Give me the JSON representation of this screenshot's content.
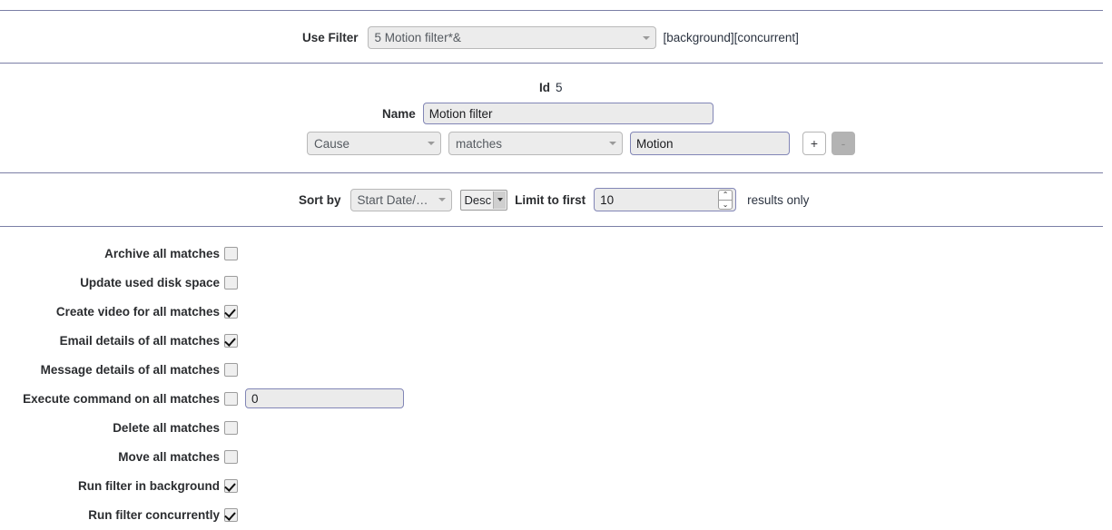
{
  "filter_bar": {
    "use_filter_label": "Use Filter",
    "selected_filter": "5 Motion filter*&",
    "tags": "[background][concurrent]"
  },
  "details": {
    "id_label": "Id",
    "id_value": "5",
    "name_label": "Name",
    "name_value": "Motion filter",
    "name_placeholder": "Name"
  },
  "condition": {
    "field": "Cause",
    "operator": "matches",
    "value": "Motion",
    "value_placeholder": "",
    "add_label": "+",
    "remove_label": "-"
  },
  "sort": {
    "sort_by_label": "Sort by",
    "sort_field": "Start Date/T…",
    "sort_direction": "Desc",
    "limit_label": "Limit to first",
    "limit_value": "10",
    "results_label": "results only",
    "spin_up": "⌃",
    "spin_down": "⌄"
  },
  "actions": [
    {
      "label": "Archive all matches",
      "checked": false
    },
    {
      "label": "Update used disk space",
      "checked": false
    },
    {
      "label": "Create video for all matches",
      "checked": true
    },
    {
      "label": "Email details of all matches",
      "checked": true
    },
    {
      "label": "Message details of all matches",
      "checked": false
    },
    {
      "label": "Execute command on all matches",
      "checked": false,
      "command_value": "0"
    },
    {
      "label": "Delete all matches",
      "checked": false
    },
    {
      "label": "Move all matches",
      "checked": false
    },
    {
      "label": "Run filter in background",
      "checked": true
    },
    {
      "label": "Run filter concurrently",
      "checked": true
    }
  ],
  "colors": {
    "rule": "#7b7fa6",
    "input_border": "#8286b6",
    "input_bg": "#ebebeb",
    "select_bg": "#ececec",
    "text": "#2b2d30",
    "disabled_button": "#b3b3b3"
  }
}
